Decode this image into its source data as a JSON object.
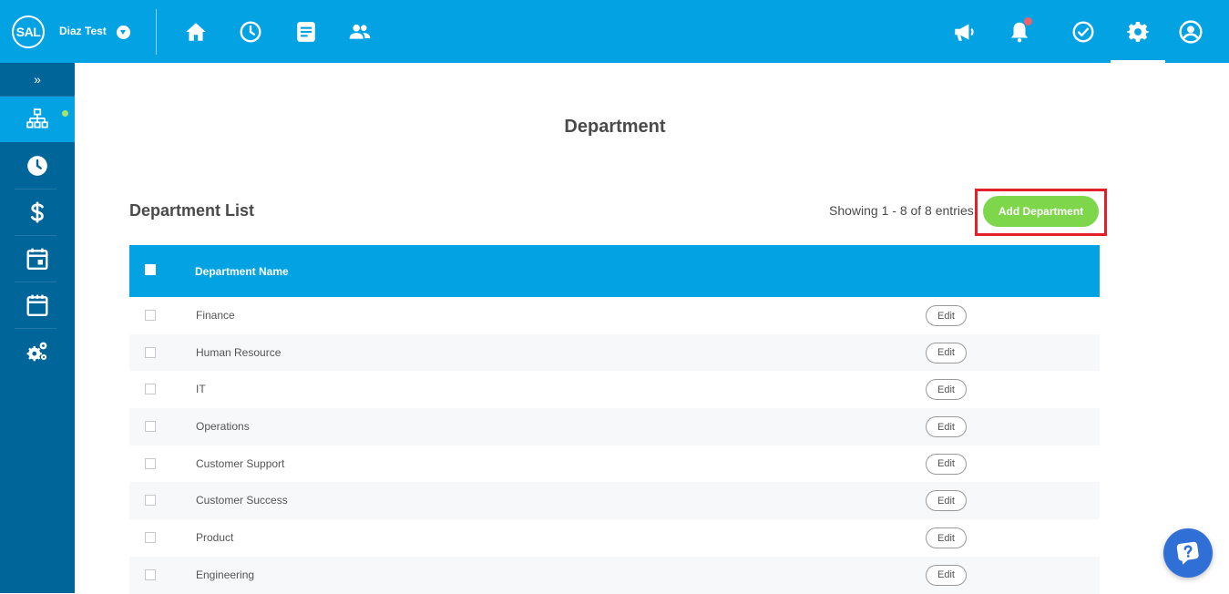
{
  "header": {
    "logo_text": "SAL",
    "account_name": "Diaz Test",
    "colors": {
      "bar": "#03a3e3",
      "notification": "#f0616b"
    },
    "left_icons": [
      "home-icon",
      "clock-icon",
      "document-icon",
      "people-icon"
    ],
    "right_icons": [
      "megaphone-icon",
      "bell-icon",
      "check-circle-icon",
      "gear-icon",
      "user-icon"
    ]
  },
  "sidebar": {
    "toggle_label": "»",
    "items": [
      "org-chart-icon",
      "clock-icon",
      "dollar-icon",
      "calendar-event-icon",
      "calendar-icon",
      "gears-icon"
    ]
  },
  "main": {
    "page_title": "Department",
    "list_title": "Department List",
    "showing_text": "Showing 1 - 8 of 8 entries",
    "add_button_label": "Add Department",
    "accent_green": "#7ed64b",
    "highlight_color": "#e3202a",
    "table": {
      "column_header": "Department Name",
      "edit_label": "Edit",
      "rows": [
        "Finance",
        "Human Resource",
        "IT",
        "Operations",
        "Customer Support",
        "Customer Success",
        "Product",
        "Engineering"
      ]
    }
  },
  "help": {
    "icon": "help-icon"
  }
}
